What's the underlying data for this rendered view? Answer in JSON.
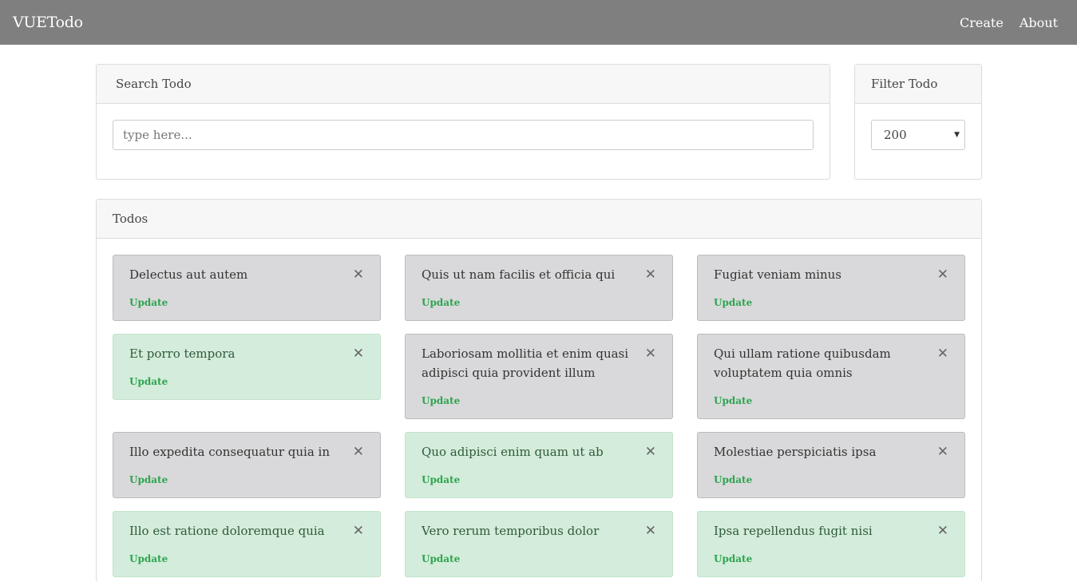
{
  "navbar": {
    "brand": "VUETodo",
    "links": [
      "Create",
      "About"
    ]
  },
  "search": {
    "title": "Search Todo",
    "placeholder": "type here..."
  },
  "filter": {
    "title": "Filter Todo",
    "selected": "200"
  },
  "todos": {
    "title": "Todos",
    "update_label": "Update",
    "close_glyph": "✕",
    "items": [
      {
        "title": "Delectus aut autem",
        "completed": false
      },
      {
        "title": "Quis ut nam facilis et officia qui",
        "completed": false
      },
      {
        "title": "Fugiat veniam minus",
        "completed": false
      },
      {
        "title": "Et porro tempora",
        "completed": true
      },
      {
        "title": "Laboriosam mollitia et enim quasi adipisci quia provident illum",
        "completed": false
      },
      {
        "title": "Qui ullam ratione quibusdam voluptatem quia omnis",
        "completed": false
      },
      {
        "title": "Illo expedita consequatur quia in",
        "completed": false
      },
      {
        "title": "Quo adipisci enim quam ut ab",
        "completed": true
      },
      {
        "title": "Molestiae perspiciatis ipsa",
        "completed": false
      },
      {
        "title": "Illo est ratione doloremque quia",
        "completed": true
      },
      {
        "title": "Vero rerum temporibus dolor",
        "completed": true
      },
      {
        "title": "Ipsa repellendus fugit nisi",
        "completed": true
      }
    ]
  },
  "colors": {
    "navbar": "#7f7f7f",
    "todo_pending": "#d9d9db",
    "todo_completed": "#d4ecdb",
    "update_link": "#2ea44f"
  }
}
